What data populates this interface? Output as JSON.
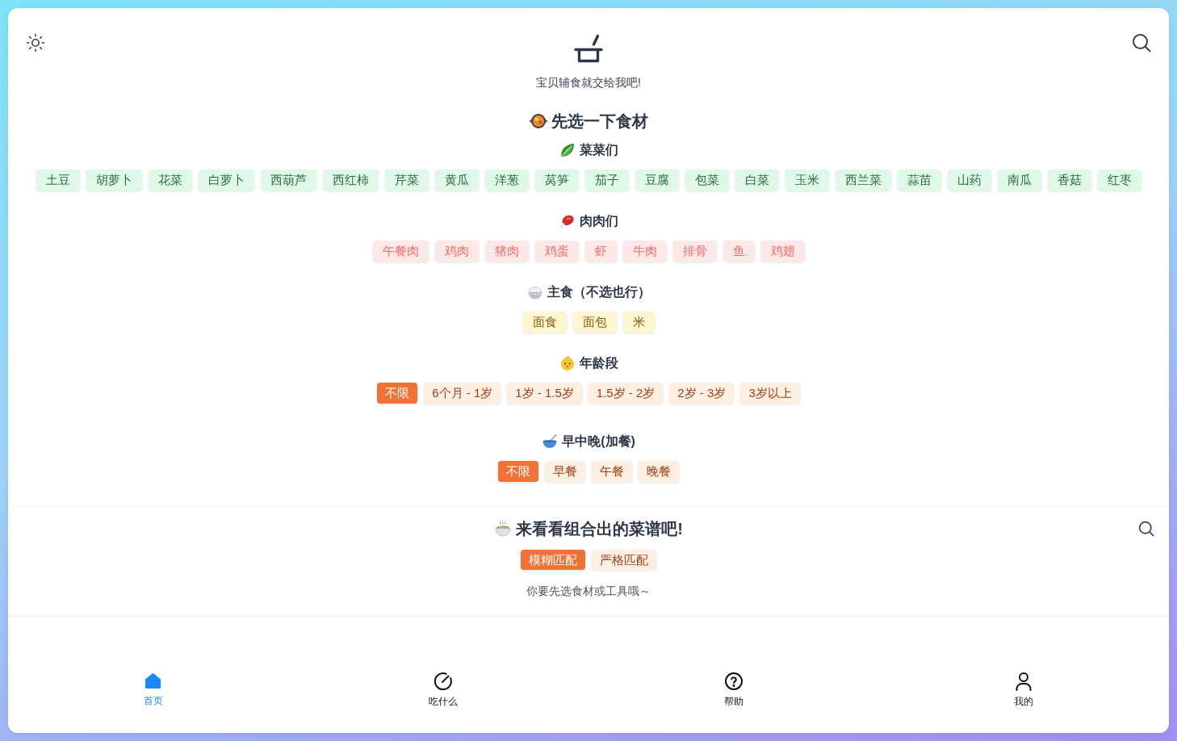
{
  "header": {
    "subtitle": "宝贝辅食就交给我吧!"
  },
  "ingredients": {
    "title": "先选一下食材",
    "groups": [
      {
        "kind": "vegetable",
        "title": "菜菜们",
        "items": [
          {
            "label": "土豆",
            "selected": false
          },
          {
            "label": "胡萝卜",
            "selected": false
          },
          {
            "label": "花菜",
            "selected": false
          },
          {
            "label": "白萝卜",
            "selected": false
          },
          {
            "label": "西葫芦",
            "selected": false
          },
          {
            "label": "西红柿",
            "selected": false
          },
          {
            "label": "芹菜",
            "selected": false
          },
          {
            "label": "黄瓜",
            "selected": false
          },
          {
            "label": "洋葱",
            "selected": false
          },
          {
            "label": "莴笋",
            "selected": false
          },
          {
            "label": "茄子",
            "selected": false
          },
          {
            "label": "豆腐",
            "selected": false
          },
          {
            "label": "包菜",
            "selected": false
          },
          {
            "label": "白菜",
            "selected": false
          },
          {
            "label": "玉米",
            "selected": false
          },
          {
            "label": "西兰菜",
            "selected": false
          },
          {
            "label": "蒜苗",
            "selected": false
          },
          {
            "label": "山药",
            "selected": false
          },
          {
            "label": "南瓜",
            "selected": false
          },
          {
            "label": "香菇",
            "selected": false
          },
          {
            "label": "红枣",
            "selected": false
          }
        ]
      },
      {
        "kind": "meat",
        "title": "肉肉们",
        "items": [
          {
            "label": "午餐肉",
            "selected": false
          },
          {
            "label": "鸡肉",
            "selected": false
          },
          {
            "label": "猪肉",
            "selected": false
          },
          {
            "label": "鸡蛋",
            "selected": false
          },
          {
            "label": "虾",
            "selected": false
          },
          {
            "label": "牛肉",
            "selected": false
          },
          {
            "label": "排骨",
            "selected": false
          },
          {
            "label": "鱼",
            "selected": false
          },
          {
            "label": "鸡翅",
            "selected": false
          }
        ]
      },
      {
        "kind": "staple",
        "title": "主食（不选也行）",
        "items": [
          {
            "label": "面食",
            "selected": false
          },
          {
            "label": "面包",
            "selected": false
          },
          {
            "label": "米",
            "selected": false
          }
        ]
      }
    ]
  },
  "age_range": {
    "title": "年龄段",
    "options": [
      {
        "label": "不限",
        "selected": true
      },
      {
        "label": "6个月 - 1岁",
        "selected": false
      },
      {
        "label": "1岁 - 1.5岁",
        "selected": false
      },
      {
        "label": "1.5岁 - 2岁",
        "selected": false
      },
      {
        "label": "2岁 - 3岁",
        "selected": false
      },
      {
        "label": "3岁以上",
        "selected": false
      }
    ]
  },
  "meal_time": {
    "title": "早中晚(加餐)",
    "options": [
      {
        "label": "不限",
        "selected": true
      },
      {
        "label": "早餐",
        "selected": false
      },
      {
        "label": "午餐",
        "selected": false
      },
      {
        "label": "晚餐",
        "selected": false
      }
    ]
  },
  "recipes": {
    "title": "来看看组合出的菜谱吧!",
    "match_modes": [
      {
        "label": "模糊匹配",
        "selected": true
      },
      {
        "label": "严格匹配",
        "selected": false
      }
    ],
    "empty_message": "你要先选食材或工具哦～"
  },
  "bottom_nav": [
    {
      "label": "首页",
      "selected": true
    },
    {
      "label": "吃什么",
      "selected": false
    },
    {
      "label": "帮助",
      "selected": false
    },
    {
      "label": "我的",
      "selected": false
    }
  ]
}
